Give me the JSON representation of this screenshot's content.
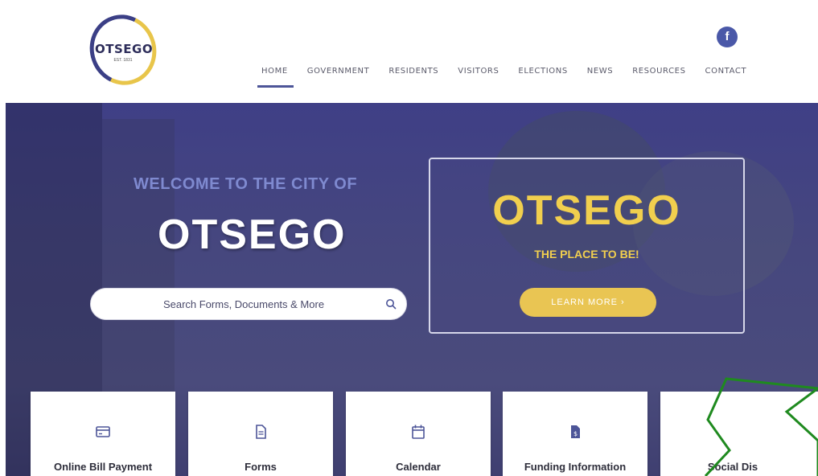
{
  "header": {
    "logo": {
      "text": "OTSEGO",
      "est": "EST. 1831"
    },
    "social": {
      "facebook": "f"
    },
    "nav": [
      {
        "label": "HOME",
        "active": true
      },
      {
        "label": "GOVERNMENT"
      },
      {
        "label": "RESIDENTS"
      },
      {
        "label": "VISITORS"
      },
      {
        "label": "ELECTIONS"
      },
      {
        "label": "NEWS"
      },
      {
        "label": "RESOURCES"
      },
      {
        "label": "CONTACT"
      }
    ]
  },
  "hero": {
    "welcome": "WELCOME TO THE CITY OF",
    "city": "OTSEGO",
    "search": {
      "placeholder": "Search Forms, Documents & More",
      "value": ""
    }
  },
  "promo": {
    "title": "OTSEGO",
    "subtitle": "THE PLACE TO BE!",
    "button": "LEARN MORE ›"
  },
  "cards": [
    {
      "label": "Online Bill Payment",
      "icon": "credit-card-icon"
    },
    {
      "label": "Forms",
      "icon": "document-icon"
    },
    {
      "label": "Calendar",
      "icon": "calendar-icon"
    },
    {
      "label": "Funding Information",
      "icon": "dollar-document-icon"
    },
    {
      "label": "Social Dis",
      "icon": ""
    }
  ],
  "colors": {
    "brand_blue": "#4d5598",
    "gold": "#e9c553",
    "hero_overlay": "#45467f",
    "arrow": "#1f8a1f"
  }
}
